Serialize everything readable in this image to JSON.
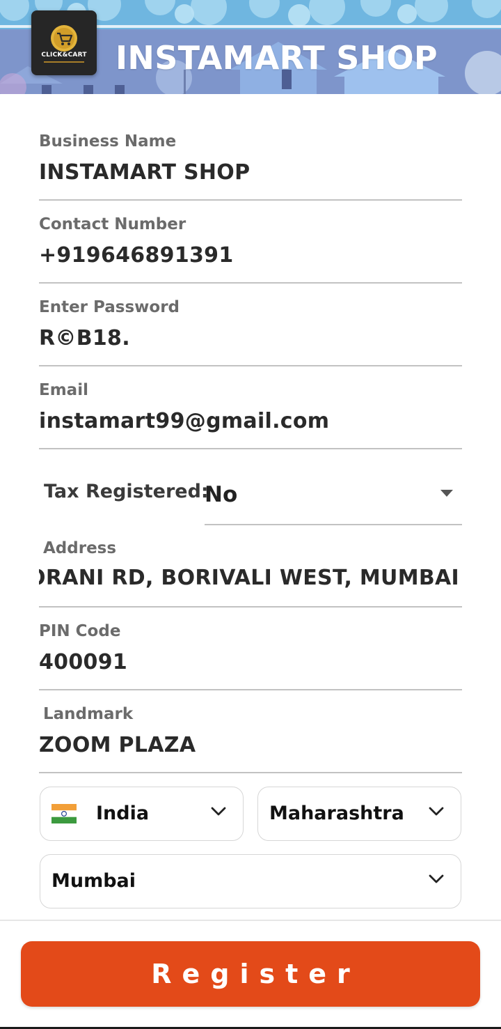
{
  "header": {
    "logo_text": "CLICK&CART",
    "title": "INSTAMART SHOP"
  },
  "form": {
    "business_name": {
      "label": "Business Name",
      "value": "INSTAMART SHOP"
    },
    "contact_number": {
      "label": "Contact Number",
      "value": "+919646891391"
    },
    "password": {
      "label": "Enter Password",
      "value": "R©B18."
    },
    "email": {
      "label": "Email",
      "value": "instamart99@gmail.com"
    },
    "tax": {
      "label": "Tax Registered:",
      "value": "No"
    },
    "address": {
      "label": "Address",
      "value": "GORANI RD, BORIVALI WEST, MUMBAI"
    },
    "pin_code": {
      "label": "PIN Code",
      "value": "400091"
    },
    "landmark": {
      "label": "Landmark",
      "value": "ZOOM PLAZA"
    },
    "country": {
      "flag_icon": "india-flag-icon",
      "value": "India"
    },
    "state": {
      "value": "Maharashtra"
    },
    "city": {
      "value": "Mumbai"
    }
  },
  "footer": {
    "register_label": "Register"
  },
  "colors": {
    "accent": "#e34a19",
    "banner_sky": "#6fb2dd",
    "banner_buildings": "#7d93c9"
  }
}
